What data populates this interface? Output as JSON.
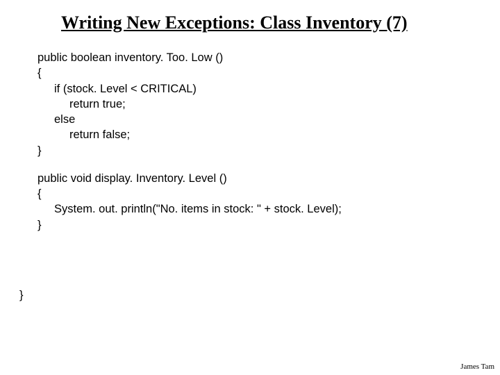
{
  "title": "Writing New Exceptions: Class Inventory (7)",
  "code": {
    "m1sig": "public boolean inventory. Too. Low ()",
    "m1open": "{",
    "m1l1": "if (stock. Level < CRITICAL)",
    "m1l2": "return true;",
    "m1l3": "else",
    "m1l4": "return false;",
    "m1close": "}",
    "m2sig": "public void display. Inventory. Level ()",
    "m2open": "{",
    "m2l1": "System. out. println(\"No. items in stock: \" + stock. Level);",
    "m2close": "}"
  },
  "outerClose": "}",
  "attribution": "James Tam"
}
